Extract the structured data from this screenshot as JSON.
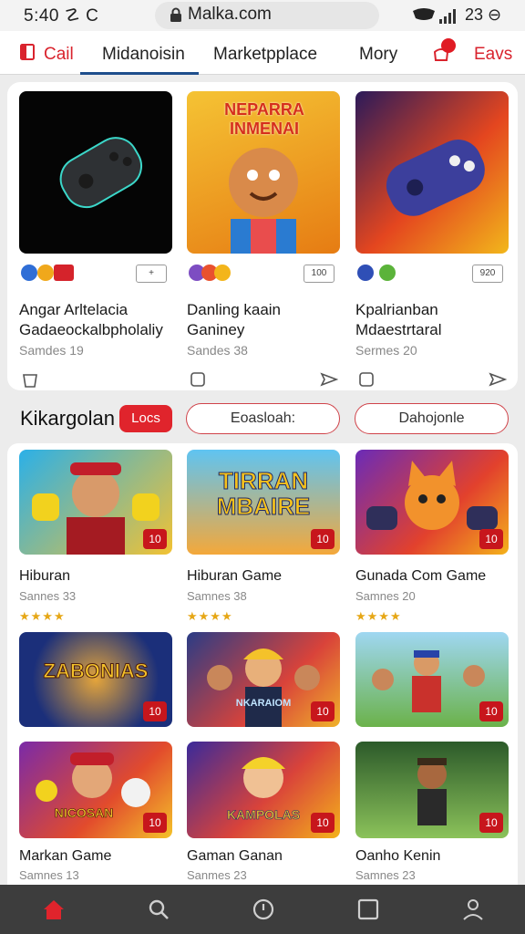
{
  "status": {
    "time": "5:40 ☡ C",
    "url": "Malka.com",
    "right_text": "23 ⊖"
  },
  "tabs": {
    "home": "Cail",
    "items": [
      "Midanoisin",
      "Marketpplace",
      "Mory"
    ],
    "right": "Eavs"
  },
  "featured": [
    {
      "title1": "Angar Arltelacia",
      "title2": "Gadaeockalbpholaliy",
      "meta": "Samdes 19",
      "mini": "+"
    },
    {
      "title1": "Danling kaain",
      "title2": "Ganiney",
      "meta": "Sandes 38",
      "mini": "100",
      "thumb_text": "NEPARRA INMENAI"
    },
    {
      "title1": "Kpalrianban",
      "title2": "Mdaestrtaral",
      "meta": "Sermes 20",
      "mini": "920"
    }
  ],
  "section": {
    "title": "Kikargolan",
    "badge": "Locs",
    "pill1": "Eoasloah:",
    "pill2": "Dahojonle"
  },
  "grid": [
    {
      "title": "Hiburan",
      "meta": "Sannes 33",
      "stars": "★★★★",
      "count": "10"
    },
    {
      "title": "Hiburan Game",
      "meta": "Samnes 38",
      "stars": "★★★★",
      "count": "10",
      "thumb_text": "TIRRAN MBAIRE"
    },
    {
      "title": "Gunada Com Game",
      "meta": "Samnes 20",
      "stars": "★★★★",
      "count": "10"
    },
    {
      "title": "",
      "meta": "",
      "stars": "",
      "count": "10",
      "thumb_text": "ZABONIAS"
    },
    {
      "title": "",
      "meta": "",
      "stars": "",
      "count": "10",
      "thumb_text": "NKARAIOM"
    },
    {
      "title": "",
      "meta": "",
      "stars": "",
      "count": "10"
    },
    {
      "title": "Markan Game",
      "meta": "Samnes 13",
      "count": "10",
      "thumb_text": "NICOSAN"
    },
    {
      "title": "Gaman Ganan",
      "meta": "Sanmes 23",
      "count": "10",
      "thumb_text": "KAMPOLAS"
    },
    {
      "title": "Oanho Kenin",
      "meta": "Samnes 23",
      "count": "10"
    }
  ],
  "colors": {
    "accent": "#d9232d",
    "tab_underline": "#1e4e8c",
    "nav_bg": "#3d3d3d"
  },
  "nav": [
    "home-icon",
    "search-icon",
    "clock-icon",
    "square-icon",
    "profile-icon"
  ]
}
